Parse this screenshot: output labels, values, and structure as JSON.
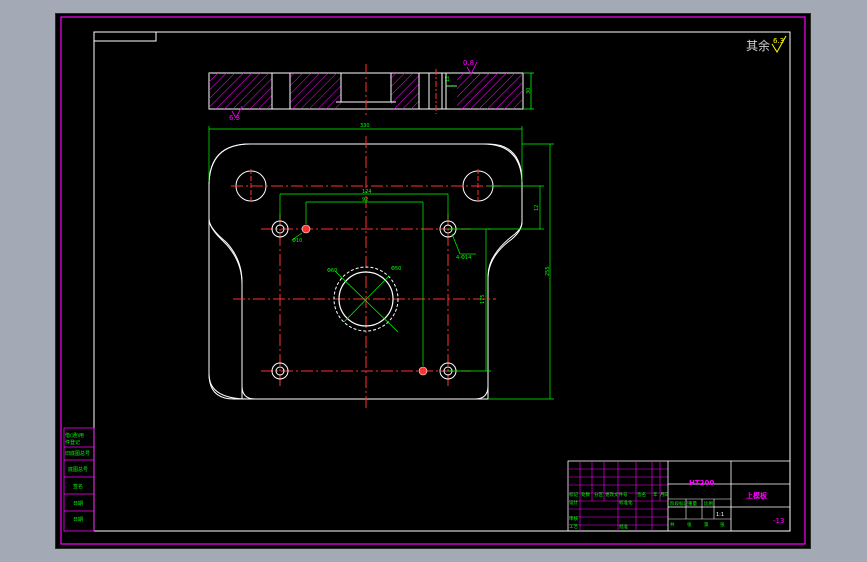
{
  "surface_finish": {
    "label": "其余",
    "value": "6.3"
  },
  "section_view": {
    "roughness": "0.8",
    "bottom_mark": "6.3",
    "height_dim": "30",
    "slot_dim": "12"
  },
  "plan_view": {
    "dims": {
      "overall_width": "330",
      "bolt_spacing_x": "124",
      "inner_spacing": "92",
      "offset_v": "12",
      "overall_height": "255",
      "hole_pitch_v": "175",
      "pin_hole": "4-Φ14",
      "dowel_hole": "Φ10",
      "center_bore": "Φ60",
      "bore_inner": "Φ50"
    }
  },
  "left_table": {
    "rows": [
      "借(通)用",
      "件登记",
      "旧底图总号",
      "底图总号",
      "签名",
      "日期",
      "日期"
    ]
  },
  "title_block": {
    "material": "HT200",
    "part_name": "上模板",
    "drawing_no": "-13",
    "scale": "1:1",
    "headers": [
      "标记",
      "处数",
      "分区",
      "更改文件号",
      "签名",
      "年",
      "月",
      "日"
    ],
    "roles": [
      "设计",
      "标准化",
      "审核",
      "工艺",
      "批准"
    ],
    "stage_labels": [
      "阶段标记",
      "重量",
      "比例"
    ],
    "sheet": [
      "共",
      "张",
      "第",
      "张"
    ]
  }
}
